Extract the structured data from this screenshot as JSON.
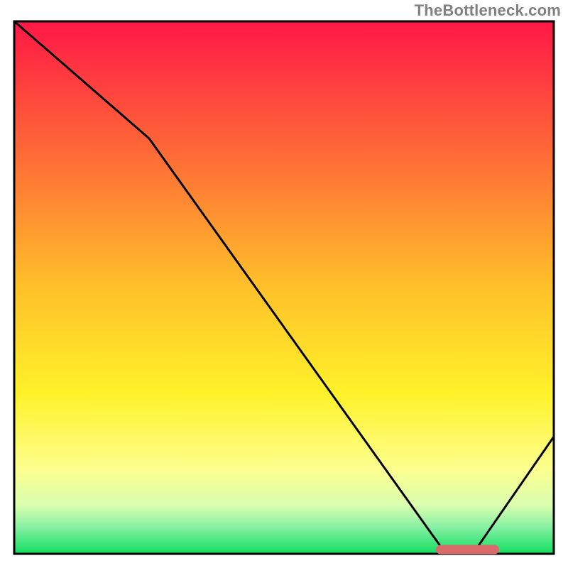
{
  "watermark": "TheBottleneck.com",
  "chart_data": {
    "type": "line",
    "title": "",
    "xlabel": "",
    "ylabel": "",
    "xlim": [
      0,
      100
    ],
    "ylim": [
      0,
      100
    ],
    "x": [
      0,
      25,
      80,
      85,
      100
    ],
    "values": [
      100,
      78,
      0,
      0,
      22
    ],
    "marker_segment": {
      "x_start": 79,
      "x_end": 89,
      "y": 0
    },
    "background_gradient_stops": [
      {
        "offset": 0.0,
        "color": "#ff1846"
      },
      {
        "offset": 0.25,
        "color": "#ff6b36"
      },
      {
        "offset": 0.5,
        "color": "#ffc129"
      },
      {
        "offset": 0.7,
        "color": "#fff22a"
      },
      {
        "offset": 0.84,
        "color": "#fdff8e"
      },
      {
        "offset": 0.91,
        "color": "#d9ffb0"
      },
      {
        "offset": 0.95,
        "color": "#86f0a3"
      },
      {
        "offset": 1.0,
        "color": "#11df5f"
      }
    ],
    "line_color": "#000000",
    "marker_color": "#d96b6b",
    "border_color": "#000000"
  }
}
